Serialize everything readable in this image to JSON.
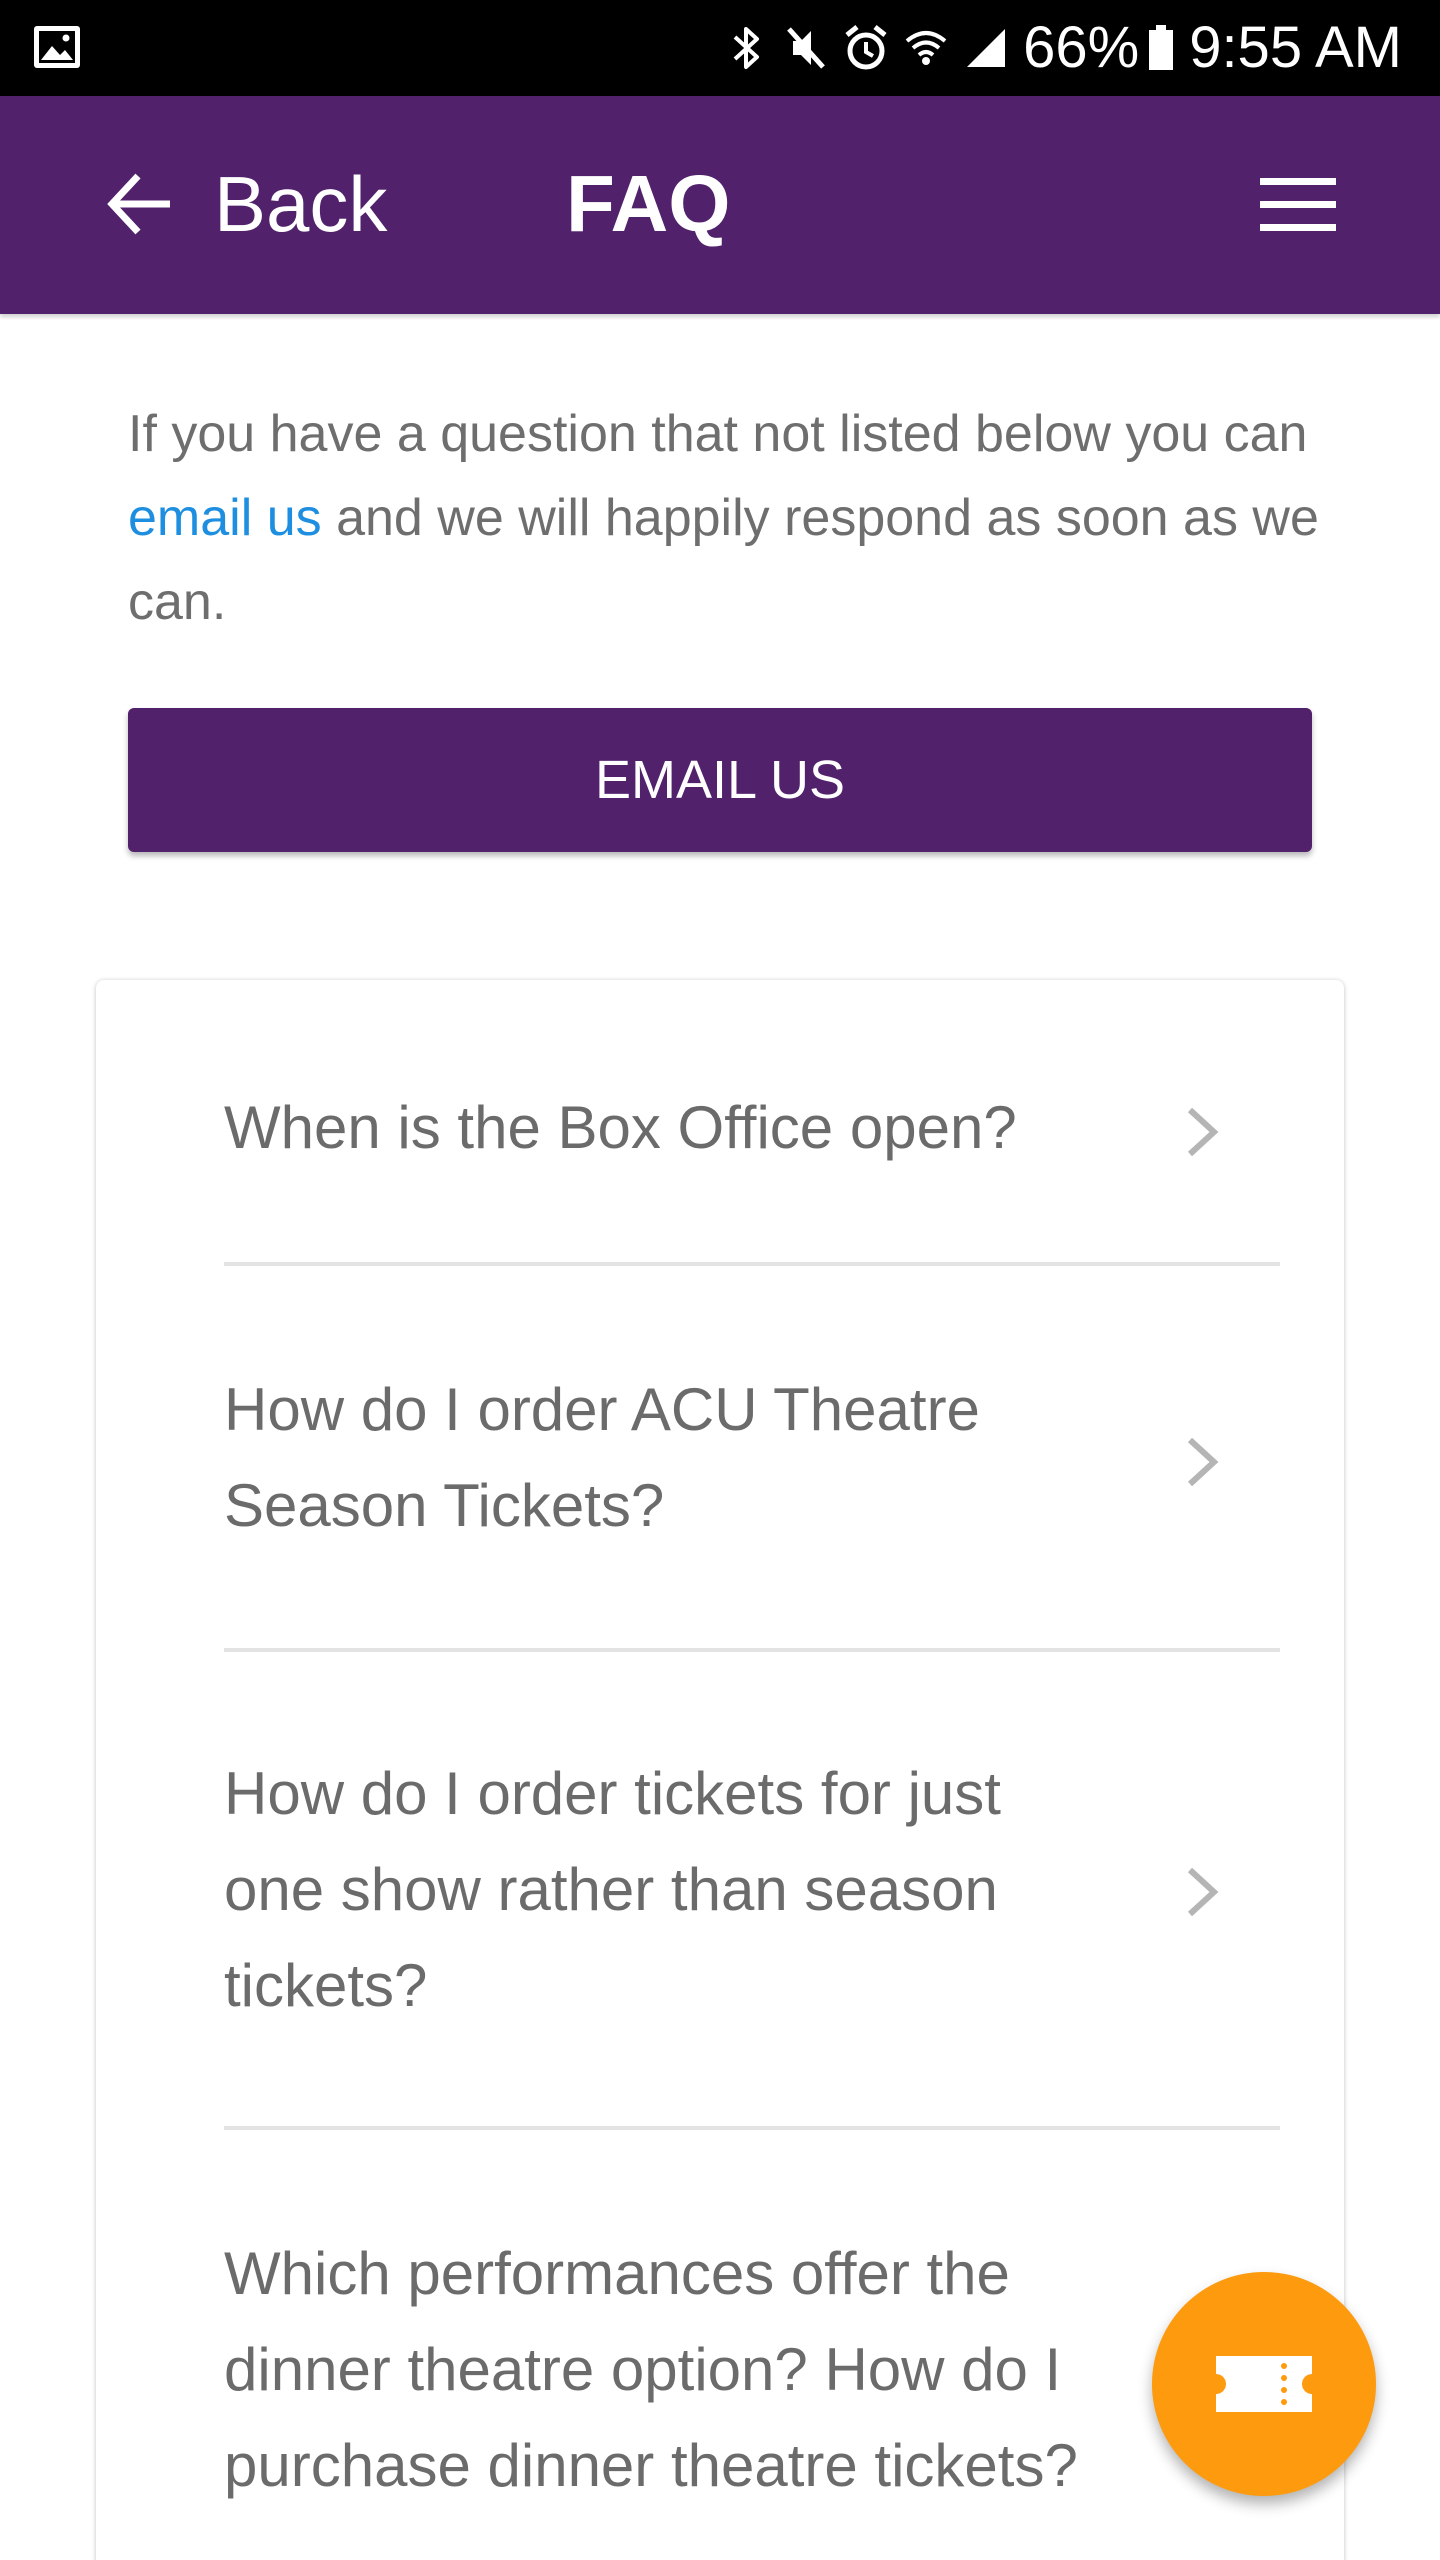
{
  "status_bar": {
    "battery": "66%",
    "time": "9:55 AM",
    "icons": [
      "image-icon",
      "bluetooth-icon",
      "mute-icon",
      "alarm-icon",
      "wifi-icon",
      "signal-icon",
      "battery-icon"
    ]
  },
  "app_bar": {
    "back_label": "Back",
    "title": "FAQ",
    "color": "#51216c"
  },
  "intro": {
    "text_before": "If you have a question that not listed below you can ",
    "link_text": "email us",
    "text_after": " and we will happily respond as soon as we can.",
    "link_color": "#1e8fe0"
  },
  "email_button": {
    "label": "EMAIL US"
  },
  "faq": {
    "items": [
      {
        "question": "When is the Box Office open?"
      },
      {
        "question": "How do I order ACU Theatre Season Tickets?"
      },
      {
        "question": "How do I order tickets for just one show rather than season tickets?"
      },
      {
        "question": "Which performances offer the dinner theatre option? How do I purchase dinner theatre tickets?"
      }
    ]
  },
  "fab": {
    "icon": "ticket-icon",
    "color": "#fd9a0e"
  }
}
